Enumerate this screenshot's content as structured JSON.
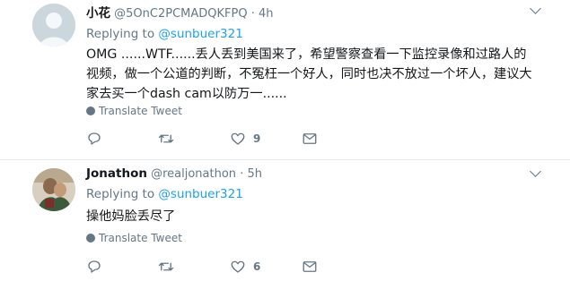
{
  "tweets": [
    {
      "display_name": "小花",
      "handle": "@5OnC2PCMADQKFPQ",
      "separator": "·",
      "time": "4h",
      "replying_prefix": "Replying to",
      "replying_to": "@sunbuer321",
      "text": "OMG ......WTF......丢人丢到美国来了，希望警察查看一下监控录像和过路人的视频，做一个公道的判断，不冤枉一个好人，同时也决不放过一个坏人，建议大家去买一个dash cam以防万一......",
      "translate": "Translate Tweet",
      "like_count": "9"
    },
    {
      "display_name": "Jonathon",
      "handle": "@realjonathon",
      "separator": "·",
      "time": "5h",
      "replying_prefix": "Replying to",
      "replying_to": "@sunbuer321",
      "text": "操他妈脸丢尽了",
      "translate": "Translate Tweet",
      "like_count": "6"
    }
  ],
  "colors": {
    "text": "#14171a",
    "muted": "#657786",
    "link": "#1da1f2",
    "divider": "#e6ecf0",
    "avatar_placeholder": "#ccd6dd"
  },
  "icons": [
    "reply-icon",
    "retweet-icon",
    "like-icon",
    "direct-message-icon",
    "globe-icon",
    "chevron-down-icon"
  ]
}
